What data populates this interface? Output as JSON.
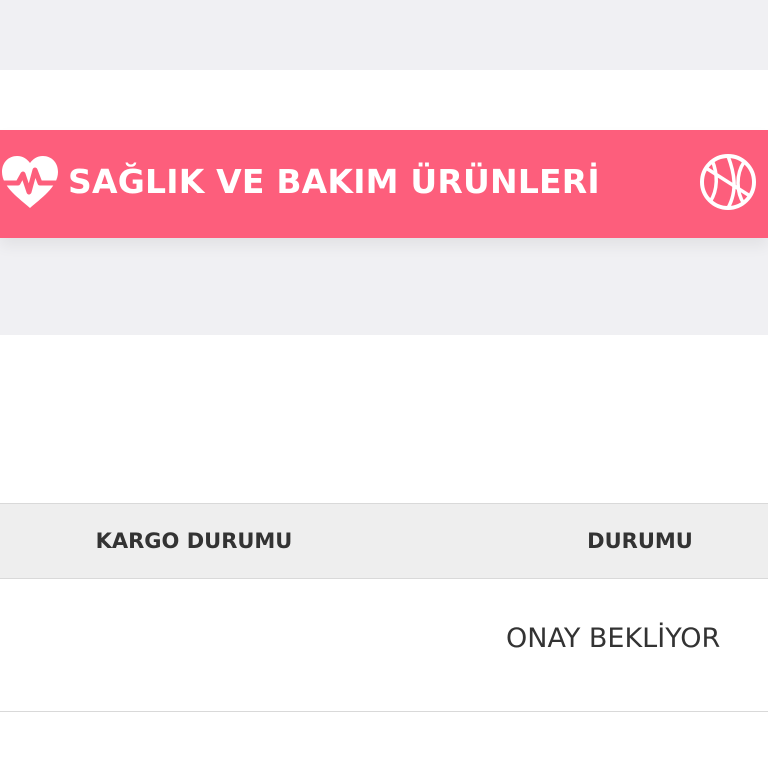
{
  "category": {
    "label": "SAĞLIK VE BAKIM ÜRÜNLERİ",
    "background": "#fd5e7c",
    "icon": "heart-pulse-icon",
    "next_icon": "basketball-icon"
  },
  "orders_table": {
    "columns": [
      "KARGO DURUMU",
      "DURUMU"
    ],
    "rows": [
      {
        "cargo_status": "",
        "status": "ONAY BEKLİYOR"
      }
    ]
  }
}
